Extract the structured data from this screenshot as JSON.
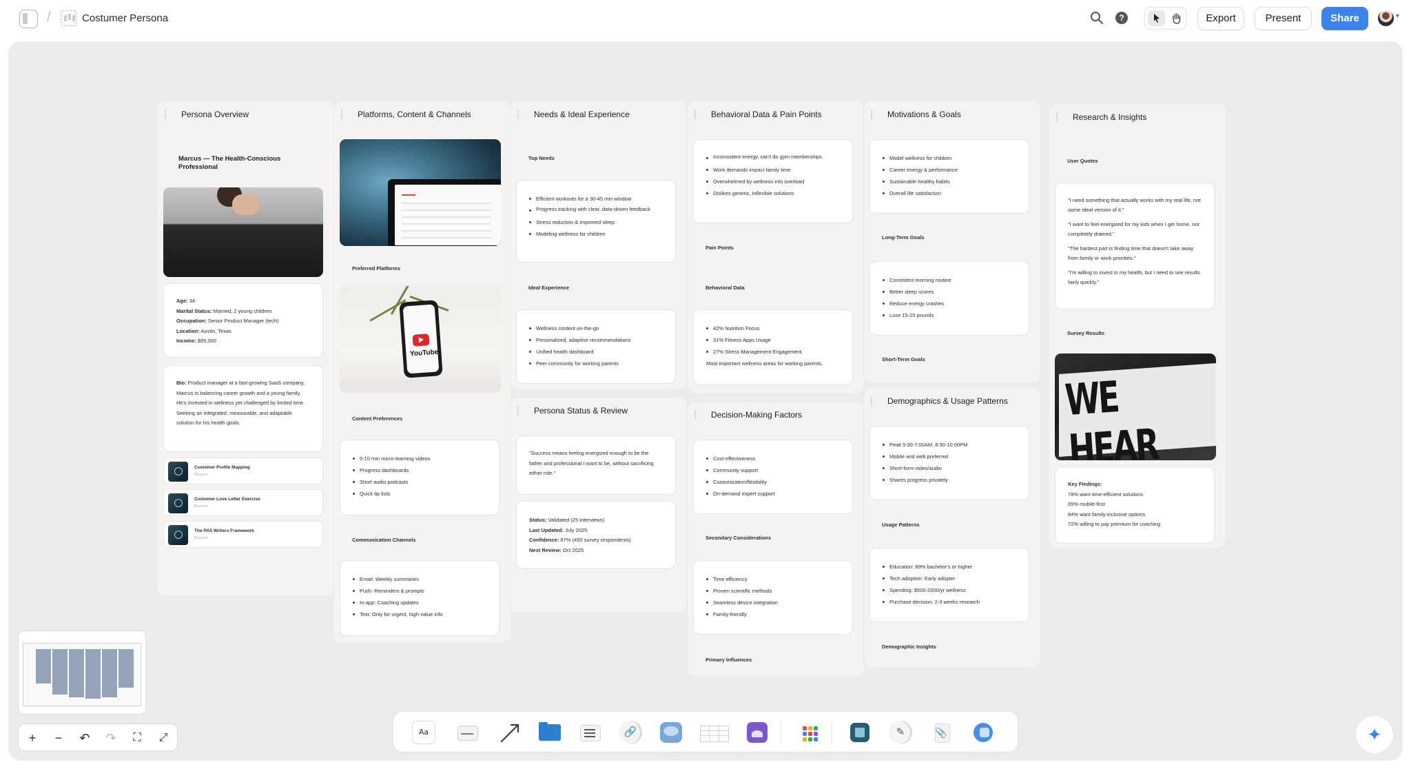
{
  "topbar": {
    "board_title": "Costumer Persona",
    "export_label": "Export",
    "present_label": "Present",
    "share_label": "Share",
    "search_icon": "search-icon",
    "help_icon": "help-icon",
    "help_glyph": "?",
    "pointer_icon": "pointer-icon",
    "hand_icon": "hand-icon"
  },
  "colors": {
    "canvas": "#ececee",
    "column": "#f4f3f1",
    "accent": "#3c83ec",
    "minimap_block": "#93a3b8"
  },
  "columns": {
    "persona": {
      "title": "Persona Overview",
      "name": "Marcus — The Health-Conscious Professional",
      "demographics": [
        {
          "label": "Age:",
          "value": " 34"
        },
        {
          "label": "Marital Status:",
          "value": " Married, 2 young children"
        },
        {
          "label": "Occupation:",
          "value": " Senior Product Manager (tech)"
        },
        {
          "label": "Location:",
          "value": " Austin, Texas"
        },
        {
          "label": "Income:",
          "value": " $95,000"
        }
      ],
      "bio_label": "Bio:",
      "bio_text": " Product manager at a fast-growing SaaS company, Marcus is balancing career growth and a young family. He's invested in wellness yet challenged by limited time. Seeking an integrated, measurable, and adaptable solution for his health goals.",
      "resources": [
        {
          "title": "Customer Profile Mapping",
          "subtitle": "Blueprint"
        },
        {
          "title": "Customer Love Letter Exercise",
          "subtitle": "Blueprint"
        },
        {
          "title": "The PAS Writers Framework",
          "subtitle": "Blueprint"
        }
      ]
    },
    "platforms": {
      "title": "Platforms, Content & Channels",
      "preferred_platforms": "Preferred Platforms",
      "youtube_word": "YouTube",
      "content_preferences": "Content Preferences",
      "content_items": [
        "5-10 min micro-learning videos",
        "Progress dashboards",
        "Short audio podcasts",
        "Quick tip lists"
      ],
      "communication_channels": "Communication Channels",
      "channel_items": [
        "Email: Weekly summaries",
        "Push: Reminders & prompts",
        "In-app: Coaching updates",
        "Text: Only for urgent, high-value info"
      ]
    },
    "needs": {
      "title": "Needs & Ideal Experience",
      "top_needs": "Top Needs",
      "needs_items": [
        "Efficient workouts for a 30-45 min window",
        "Progress tracking with clear, data-driven feedback",
        "Stress reduction & improved sleep",
        "Modeling wellness for children"
      ],
      "ideal_experience": "Ideal Experience",
      "ideal_items": [
        "Wellness content on-the-go",
        "Personalized, adaptive recommendations",
        "Unified health dashboard",
        "Peer community for working parents"
      ]
    },
    "status": {
      "title": "Persona Status & Review",
      "quote": "\"Success means feeling energized enough to be the father and professional I want to be, without sacrificing either role.\"",
      "fields": [
        {
          "label": "Status:",
          "value": " Validated (25 interviews)"
        },
        {
          "label": "Last Updated:",
          "value": " July 2025"
        },
        {
          "label": "Confidence:",
          "value": " 87% (450 survey respondents)"
        },
        {
          "label": "Next Review:",
          "value": " Oct 2025"
        }
      ]
    },
    "behavioral": {
      "title": "Behavioral Data & Pain Points",
      "pain_items": [
        "Inconsistent energy, can't do gym memberships",
        "Work demands impact family time",
        "Overwhelmed by wellness info overload",
        "Dislikes generic, inflexible solutions"
      ],
      "pain_points": "Pain Points",
      "behavioral_data": "Behavioral Data",
      "data_items": [
        "42% Nutrition Focus",
        "31% Fitness Apps Usage",
        "27% Stress Management Engagement"
      ],
      "data_caption": "Most important wellness areas for working parents."
    },
    "decision": {
      "title": "Decision-Making Factors",
      "primary_items": [
        "Cost-effectiveness",
        "Community support",
        "Customization/flexibility",
        "On-demand expert support"
      ],
      "secondary_considerations": "Secondary Considerations",
      "secondary_items": [
        "Time efficiency",
        "Proven scientific methods",
        "Seamless device integration",
        "Family-friendly"
      ],
      "primary_influences": "Primary Influences"
    },
    "motivations": {
      "title": "Motivations & Goals",
      "long_items": [
        "Model wellness for children",
        "Career energy & performance",
        "Sustainable healthy habits",
        "Overall life satisfaction"
      ],
      "long_term_goals": "Long-Term Goals",
      "short_items": [
        "Consistent morning routine",
        "Better sleep scores",
        "Reduce energy crashes",
        "Lose 15-20 pounds"
      ],
      "short_term_goals": "Short-Term Goals"
    },
    "demographics": {
      "title": "Demographics & Usage Patterns",
      "usage_items": [
        "Peak 5:30-7:00AM, 8:30-10:00PM",
        "Mobile and web preferred",
        "Short-form video/audio",
        "Shares progress privately"
      ],
      "usage_patterns": "Usage Patterns",
      "insight_items": [
        "Education: 89% bachelor's or higher",
        "Tech adoption: Early adopter",
        "Spending: $500-2000/yr wellness",
        "Purchase decision: 2-3 weeks research"
      ],
      "demographic_insights": "Demographic Insights"
    },
    "research": {
      "title": "Research & Insights",
      "user_quotes": "User Quotes",
      "quotes": [
        "\"I need something that actually works with my real life, not some ideal version of it.\"",
        "\"I want to feel energized for my kids when I get home, not completely drained.\"",
        "\"The hardest part is finding time that doesn't take away from family or work priorities.\"",
        "\"I'm willing to invest in my health, but I need to see results fairly quickly.\""
      ],
      "survey_results": "Survey Results",
      "sign_text": "WE HEAR YOU.",
      "key_findings_label": "Key Findings:",
      "findings": [
        "78% want time-efficient solutions",
        "65% mobile-first",
        "84% want family-inclusive options",
        "72% willing to pay premium for coaching"
      ]
    }
  },
  "toolbar": {
    "text_label": "Aa",
    "tools": [
      "text-tool",
      "note-tool",
      "arrow-tool",
      "folder-tool",
      "todo-tool",
      "link-tool",
      "comment-tool",
      "table-tool",
      "image-tool",
      "apps-tool",
      "frame-tool",
      "pen-tool",
      "attachment-tool",
      "camera-tool"
    ]
  },
  "zoom": {
    "zoom_in": "+",
    "zoom_out": "−",
    "undo": "↶",
    "redo": "↷",
    "fit": "⛶",
    "expand": "⤢"
  },
  "ai_glyph": "✦"
}
